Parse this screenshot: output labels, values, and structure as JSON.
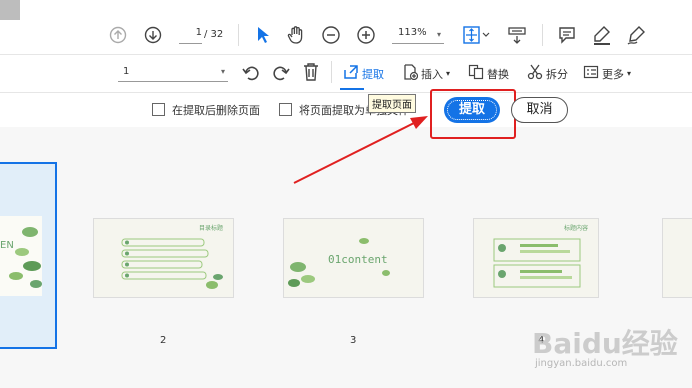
{
  "toolbar": {
    "page_current": "1",
    "page_total": "/ 32",
    "zoom_value": "113%",
    "icons": [
      "up-arrow-icon",
      "down-arrow-icon",
      "pointer-icon",
      "hand-icon",
      "zoom-out-icon",
      "zoom-in-icon",
      "fit-page-icon",
      "scroll-mode-icon",
      "comment-icon",
      "highlight-icon",
      "pen-icon"
    ]
  },
  "organize": {
    "page_range_value": "1",
    "extract_label": "提取",
    "insert_label": "插入",
    "replace_label": "替换",
    "split_label": "拆分",
    "more_label": "更多"
  },
  "options": {
    "delete_after_label": "在提取后删除页面",
    "separate_files_label": "将页面提取为单独文件",
    "tooltip": "提取页面",
    "extract_button": "提取",
    "cancel_button": "取消"
  },
  "thumbnails": [
    {
      "label": "",
      "text": "EN"
    },
    {
      "label": "2",
      "title": "目录标题"
    },
    {
      "label": "3",
      "text": "01content"
    },
    {
      "label": "4",
      "title": "标题内容"
    }
  ],
  "watermark": {
    "main": "Baidu经验",
    "sub": "jingyan.baidu.com"
  },
  "colors": {
    "accent": "#1473e6",
    "annotation": "#e02020"
  }
}
